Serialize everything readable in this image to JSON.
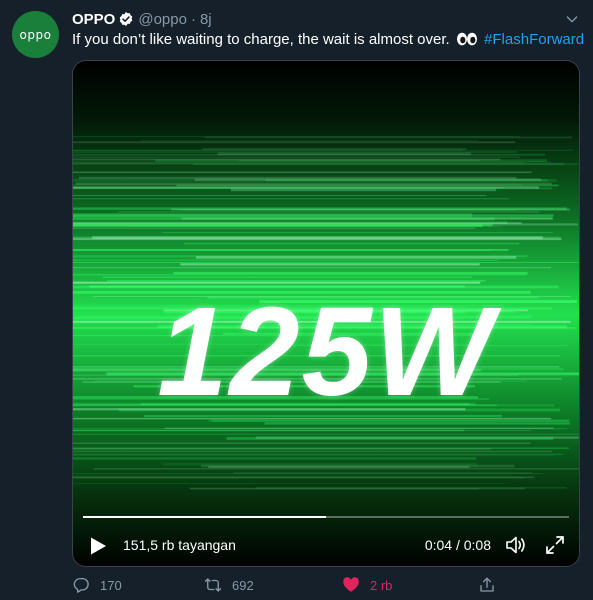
{
  "tweet": {
    "avatar_text": "oppo",
    "author_name": "OPPO",
    "handle": "@oppo",
    "separator": "·",
    "time": "8j",
    "text_before": "If you don’t like waiting to charge, the wait is almost over.",
    "emoji": "eyes",
    "hashtag": "#FlashForward"
  },
  "media": {
    "big_text": "125W",
    "views": "151,5 rb tayangan",
    "timecode": "0:04 / 0:08",
    "progress_fraction": 0.5
  },
  "actions": {
    "reply_count": "170",
    "retweet_count": "692",
    "like_count": "2 rb"
  },
  "colors": {
    "background": "#15202b",
    "secondary_text": "#8899a6",
    "link": "#1da1f2",
    "like": "#e0245e",
    "avatar": "#1a7f3b",
    "video_green": "#1fd14a"
  },
  "icons": {
    "verified": "verified-badge-icon",
    "more": "chevron-down-icon",
    "play": "play-icon",
    "volume": "volume-icon",
    "fullscreen": "fullscreen-icon",
    "reply": "reply-icon",
    "retweet": "retweet-icon",
    "like": "heart-icon",
    "share": "share-icon"
  }
}
